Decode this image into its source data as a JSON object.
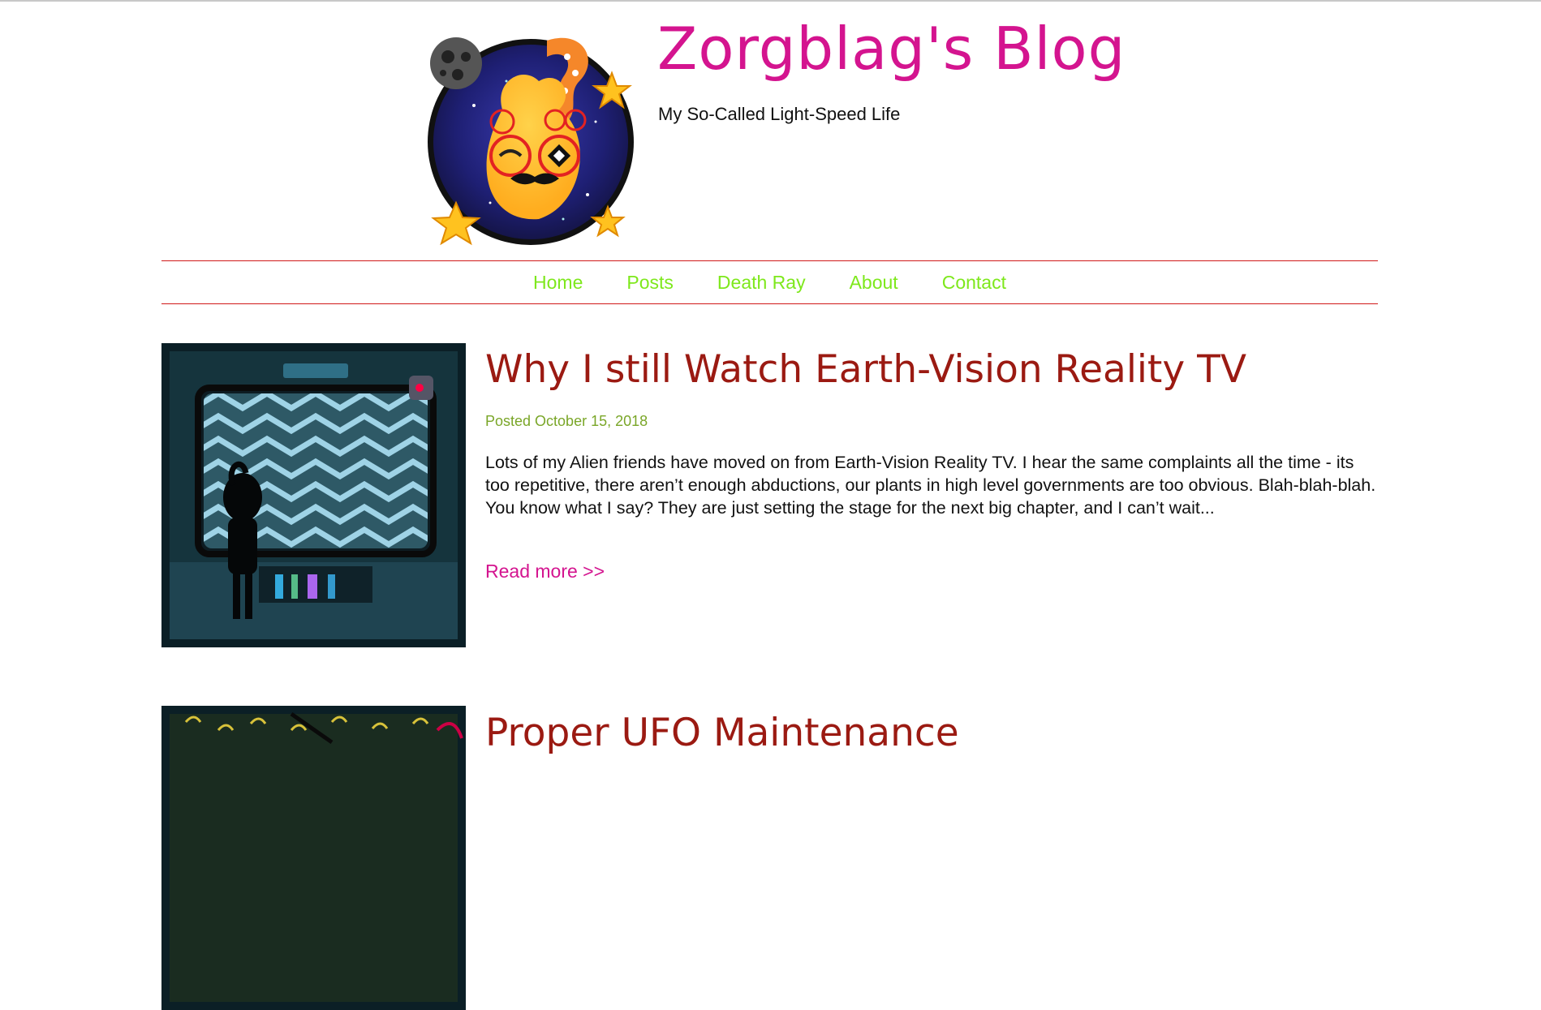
{
  "site": {
    "title": "Zorgblag's Blog",
    "subtitle": "My So-Called Light-Speed Life"
  },
  "nav": {
    "items": [
      {
        "label": "Home"
      },
      {
        "label": "Posts"
      },
      {
        "label": "Death Ray"
      },
      {
        "label": "About"
      },
      {
        "label": "Contact"
      }
    ]
  },
  "posts": [
    {
      "title": "Why I still Watch Earth-Vision Reality TV",
      "date": "Posted October 15, 2018",
      "excerpt": "Lots of my Alien friends have moved on from Earth-Vision Reality TV. I hear the same complaints all the time - its too repetitive, there aren’t enough abductions, our plants in high level governments are too obvious. Blah-blah-blah. You know what I say? They are just setting the stage for the next big chapter, and I can’t wait...",
      "read_more": "Read more >>",
      "thumbnail_icon": "alien-watching-tv-illustration"
    },
    {
      "title": "Proper UFO Maintenance",
      "thumbnail_icon": "ufo-illustration"
    }
  ],
  "colors": {
    "title": "#d4148f",
    "nav_link": "#7ee81c",
    "post_title": "#9b1a12",
    "post_date": "#7aa628",
    "rule": "#d01818"
  }
}
